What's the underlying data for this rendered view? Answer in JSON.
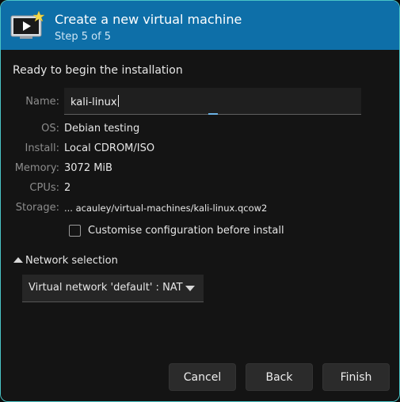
{
  "header": {
    "title": "Create a new virtual machine",
    "step": "Step 5 of 5"
  },
  "summary": {
    "ready_text": "Ready to begin the installation",
    "name_label": "Name:",
    "name_value": "kali-linux",
    "os_label": "OS:",
    "os_value": "Debian testing",
    "install_label": "Install:",
    "install_value": "Local CDROM/ISO",
    "memory_label": "Memory:",
    "memory_value": "3072 MiB",
    "cpus_label": "CPUs:",
    "cpus_value": "2",
    "storage_label": "Storage:",
    "storage_value": "... acauley/virtual-machines/kali-linux.qcow2"
  },
  "options": {
    "customise_label": "Customise configuration before install",
    "customise_checked": false
  },
  "network": {
    "expander_label": "Network selection",
    "selected": "Virtual network 'default' : NAT"
  },
  "buttons": {
    "cancel": "Cancel",
    "back": "Back",
    "finish": "Finish"
  },
  "colors": {
    "header_bg": "#0e6fa8",
    "window_border": "#49c4c6",
    "background": "#141414"
  }
}
